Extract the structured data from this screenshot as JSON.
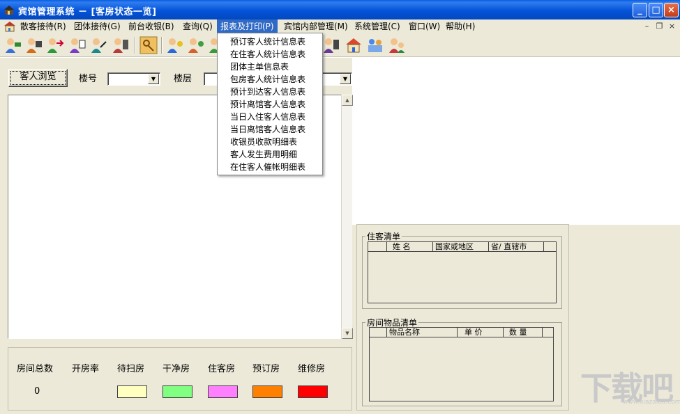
{
  "window": {
    "title": "宾馆管理系统 － [客房状态一览]"
  },
  "menu": {
    "items": [
      {
        "label": "散客接待(R)"
      },
      {
        "label": "团体接待(G)"
      },
      {
        "label": "前台收银(B)"
      },
      {
        "label": "查询(Q)"
      },
      {
        "label": "报表及打印(P)"
      },
      {
        "label": "宾馆内部管理(M)"
      },
      {
        "label": "系统管理(C)"
      },
      {
        "label": "窗口(W)"
      },
      {
        "label": "帮助(H)"
      }
    ],
    "open_index": 4
  },
  "dropdown": {
    "items": [
      "预订客人统计信息表",
      "在住客人统计信息表",
      "团体主单信息表",
      "包房客人统计信息表",
      "预计到达客人信息表",
      "预计离馆客人信息表",
      "当日入住客人信息表",
      "当日离馆客人信息表",
      "收银员收款明细表",
      "客人发生费用明细",
      "在住客人催帐明细表"
    ]
  },
  "filter": {
    "browse_button": "客人浏览",
    "room_label": "楼号",
    "room_value": "",
    "floor_label": "楼层",
    "floor_value": ""
  },
  "stats": {
    "labels": [
      "房间总数",
      "开房率",
      "待扫房",
      "干净房",
      "住客房",
      "预订房",
      "维修房"
    ],
    "total_rooms": "0",
    "legend_colors": {
      "待扫房": "#ffffc0",
      "干净房": "#80ff80",
      "住客房": "#ff80ff",
      "预订房": "#ff8000",
      "维修房": "#ff0000"
    }
  },
  "guest_list": {
    "title": "住客清单",
    "columns": [
      "姓  名",
      "国家或地区",
      "省/ 直辖市"
    ]
  },
  "item_list": {
    "title": "房间物品清单",
    "columns": [
      "物品名称",
      "单  价",
      "数  量"
    ]
  },
  "watermark": {
    "text": "下载吧",
    "url": "www.xiazaiba.com"
  }
}
